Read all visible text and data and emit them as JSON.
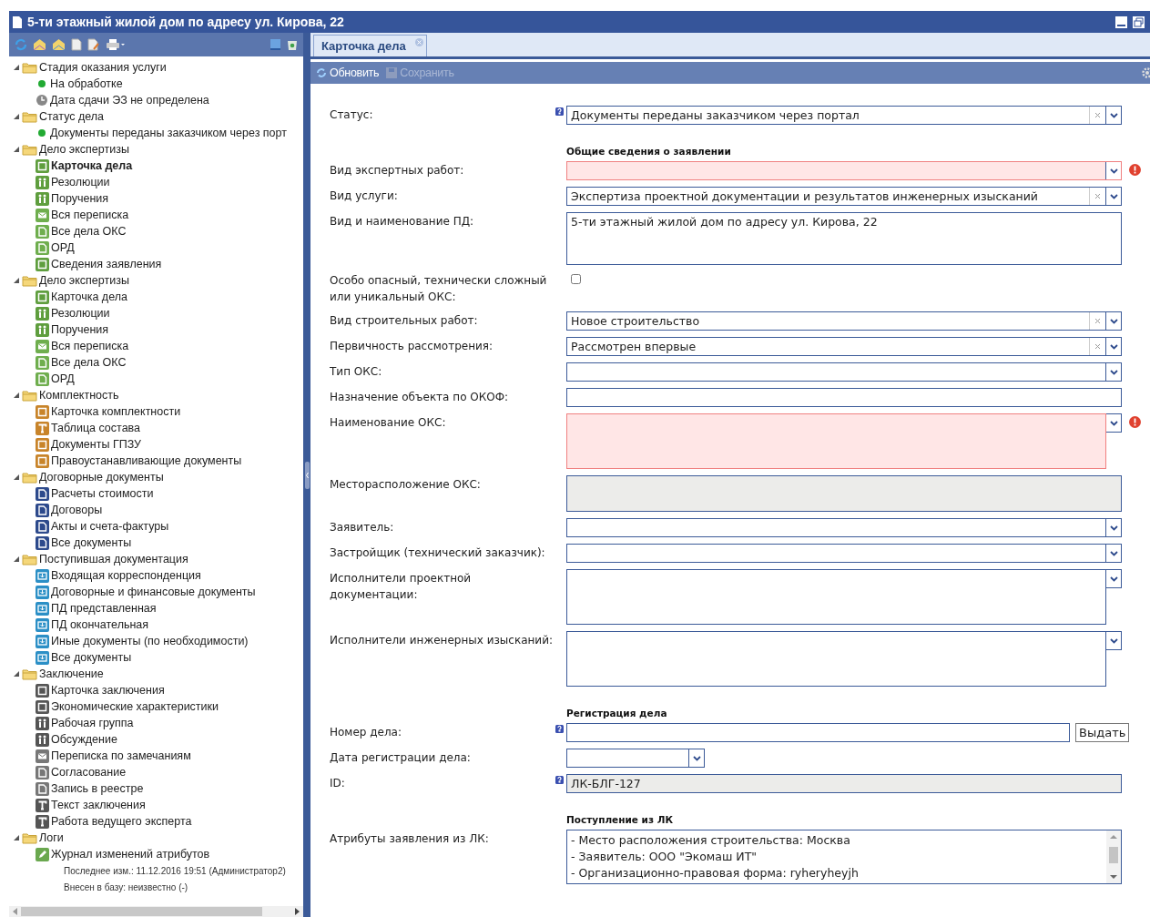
{
  "window": {
    "title": "5-ти этажный жилой дом по адресу ул. Кирова, 22"
  },
  "tree": [
    {
      "label": "Стадия оказания услуги",
      "expanded": true,
      "children": [
        {
          "label": "На обработке",
          "kind": "dot",
          "color": "#22aa33",
          "selected": false
        },
        {
          "label": "Дата сдачи ЭЗ не определена",
          "kind": "clock",
          "color": "#888888",
          "selected": false
        }
      ]
    },
    {
      "label": "Статус дела",
      "expanded": true,
      "children": [
        {
          "label": "Документы переданы заказчиком через порт",
          "kind": "dot",
          "color": "#22aa33",
          "selected": false
        }
      ]
    },
    {
      "label": "Дело экспертизы",
      "expanded": true,
      "children": [
        {
          "label": "Карточка дела",
          "kind": "form",
          "color": "#5f9e3e",
          "selected": true
        },
        {
          "label": "Резолюции",
          "kind": "people",
          "color": "#5f9e3e",
          "selected": false
        },
        {
          "label": "Поручения",
          "kind": "people",
          "color": "#5f9e3e",
          "selected": false
        },
        {
          "label": "Вся переписка",
          "kind": "mail",
          "color": "#6fae4e",
          "selected": false
        },
        {
          "label": "Все дела ОКС",
          "kind": "doc",
          "color": "#6fae4e",
          "selected": false
        },
        {
          "label": "ОРД",
          "kind": "doc",
          "color": "#6fae4e",
          "selected": false
        },
        {
          "label": "Сведения заявления",
          "kind": "form",
          "color": "#5f9e3e",
          "selected": false
        }
      ]
    },
    {
      "label": "Дело экспертизы",
      "expanded": true,
      "children": [
        {
          "label": "Карточка дела",
          "kind": "form",
          "color": "#5f9e3e",
          "selected": false
        },
        {
          "label": "Резолюции",
          "kind": "people",
          "color": "#5f9e3e",
          "selected": false
        },
        {
          "label": "Поручения",
          "kind": "people",
          "color": "#5f9e3e",
          "selected": false
        },
        {
          "label": "Вся переписка",
          "kind": "mail",
          "color": "#6fae4e",
          "selected": false
        },
        {
          "label": "Все дела ОКС",
          "kind": "doc",
          "color": "#6fae4e",
          "selected": false
        },
        {
          "label": "ОРД",
          "kind": "doc",
          "color": "#6fae4e",
          "selected": false
        }
      ]
    },
    {
      "label": "Комплектность",
      "expanded": true,
      "children": [
        {
          "label": "Карточка комплектности",
          "kind": "form",
          "color": "#c8842a",
          "selected": false
        },
        {
          "label": "Таблица состава",
          "kind": "text",
          "color": "#c8842a",
          "selected": false
        },
        {
          "label": "Документы ГПЗУ",
          "kind": "form",
          "color": "#c8842a",
          "selected": false
        },
        {
          "label": "Правоустанавливающие документы",
          "kind": "form",
          "color": "#c8842a",
          "selected": false
        }
      ]
    },
    {
      "label": "Договорные документы",
      "expanded": true,
      "children": [
        {
          "label": "Расчеты стоимости",
          "kind": "doc",
          "color": "#2d4a8c",
          "selected": false
        },
        {
          "label": "Договоры",
          "kind": "doc",
          "color": "#2d4a8c",
          "selected": false
        },
        {
          "label": "Акты и счета-фактуры",
          "kind": "doc",
          "color": "#2d4a8c",
          "selected": false
        },
        {
          "label": "Все документы",
          "kind": "doc",
          "color": "#2d4a8c",
          "selected": false
        }
      ]
    },
    {
      "label": "Поступившая документация",
      "expanded": true,
      "children": [
        {
          "label": "Входящая корреспонденция",
          "kind": "inbox",
          "color": "#2b8fc6",
          "selected": false
        },
        {
          "label": "Договорные и финансовые документы",
          "kind": "inbox",
          "color": "#2b8fc6",
          "selected": false
        },
        {
          "label": "ПД представленная",
          "kind": "inbox",
          "color": "#2b8fc6",
          "selected": false
        },
        {
          "label": "ПД окончательная",
          "kind": "inbox",
          "color": "#2b8fc6",
          "selected": false
        },
        {
          "label": "Иные документы (по необходимости)",
          "kind": "inbox",
          "color": "#2b8fc6",
          "selected": false
        },
        {
          "label": "Все документы",
          "kind": "inbox",
          "color": "#2b8fc6",
          "selected": false
        }
      ]
    },
    {
      "label": "Заключение",
      "expanded": true,
      "children": [
        {
          "label": "Карточка заключения",
          "kind": "form",
          "color": "#555555",
          "selected": false
        },
        {
          "label": "Экономические характеристики",
          "kind": "form",
          "color": "#555555",
          "selected": false
        },
        {
          "label": "Рабочая группа",
          "kind": "people",
          "color": "#555555",
          "selected": false
        },
        {
          "label": "Обсуждение",
          "kind": "people",
          "color": "#555555",
          "selected": false
        },
        {
          "label": "Переписка по замечаниям",
          "kind": "mail",
          "color": "#777777",
          "selected": false
        },
        {
          "label": "Согласование",
          "kind": "doc",
          "color": "#777777",
          "selected": false
        },
        {
          "label": "Запись в реестре",
          "kind": "doc",
          "color": "#777777",
          "selected": false
        },
        {
          "label": "Текст заключения",
          "kind": "text",
          "color": "#555555",
          "selected": false
        },
        {
          "label": "Работа ведущего эксперта",
          "kind": "text",
          "color": "#555555",
          "selected": false
        }
      ]
    },
    {
      "label": "Логи",
      "expanded": true,
      "children": [
        {
          "label": "Журнал изменений атрибутов",
          "kind": "pencil",
          "color": "#6aa84f",
          "selected": false
        }
      ]
    }
  ],
  "tree_notes": [
    "Последнее изм.: 11.12.2016 19:51 (Администратор2)",
    "Внесен в базу: неизвестно (-)"
  ],
  "tabs": [
    {
      "label": "Карточка дела",
      "selected": true
    }
  ],
  "toolbar": [
    {
      "label": "Обновить",
      "kind": "refresh",
      "disabled": false
    },
    {
      "label": "Сохранить",
      "kind": "save",
      "disabled": true
    }
  ],
  "form": [
    {
      "kind": "combo",
      "label": "Статус:",
      "value": "Документы переданы заказчиком через портал",
      "help": true,
      "clearable": true,
      "invalid": false
    },
    {
      "kind": "section",
      "title": "Общие сведения о заявлении"
    },
    {
      "kind": "combo",
      "label": "Вид экспертных работ:",
      "help": false,
      "clearable": false,
      "invalid": true
    },
    {
      "kind": "combo",
      "label": "Вид услуги:",
      "value": "Экспертиза проектной документации и результатов инженерных изысканий",
      "help": false,
      "clearable": true,
      "invalid": false
    },
    {
      "kind": "textarea",
      "label": "Вид и наименование ПД:",
      "value": "5-ти этажный жилой дом по адресу ул. Кирова, 22",
      "help": false,
      "invalid": false
    },
    {
      "kind": "checkbox",
      "label": "Особо опасный, технически сложный\nили уникальный ОКС:",
      "help": false,
      "checked": false
    },
    {
      "kind": "combo",
      "label": "Вид строительных работ:",
      "value": "Новое строительство",
      "help": false,
      "clearable": true,
      "invalid": false
    },
    {
      "kind": "combo",
      "label": "Первичность рассмотрения:",
      "value": "Рассмотрен впервые",
      "help": false,
      "clearable": true,
      "invalid": false
    },
    {
      "kind": "combo",
      "label": "Тип ОКС:",
      "help": false,
      "clearable": false,
      "invalid": false
    },
    {
      "kind": "text",
      "label": "Назначение объекта по ОКОФ:",
      "help": false,
      "invalid": false
    },
    {
      "kind": "multicombo",
      "label": "Наименование ОКС:",
      "help": false,
      "invalid": true
    },
    {
      "kind": "readonly",
      "label": "Месторасположение ОКС:",
      "help": false
    },
    {
      "kind": "combo",
      "label": "Заявитель:",
      "help": false,
      "clearable": false,
      "invalid": false
    },
    {
      "kind": "combo",
      "label": "Застройщик (технический заказчик):",
      "help": false,
      "clearable": false,
      "invalid": false
    },
    {
      "kind": "multicombo",
      "label": "Исполнители проектной\nдокументации:",
      "help": false,
      "invalid": false
    },
    {
      "kind": "multicombo",
      "label": "Исполнители инженерных изысканий:",
      "help": false,
      "invalid": false
    },
    {
      "kind": "section",
      "title": "Регистрация дела"
    },
    {
      "kind": "number",
      "label": "Номер дела:",
      "help": true,
      "button": "Выдать"
    },
    {
      "kind": "date",
      "label": "Дата регистрации дела:",
      "help": false
    },
    {
      "kind": "readonly",
      "label": "ID:",
      "value": "ЛК-БЛГ-127",
      "help": true
    },
    {
      "kind": "section",
      "title": "Поступление из ЛК"
    },
    {
      "kind": "list",
      "label": "Атрибуты заявления из ЛК:",
      "help": false,
      "lines": [
        "- Место расположения строительства: Москва",
        "- Заявитель: ООО \"Экомаш ИТ\"",
        "- Организационно-правовая форма: ryheryheyjh"
      ]
    }
  ]
}
